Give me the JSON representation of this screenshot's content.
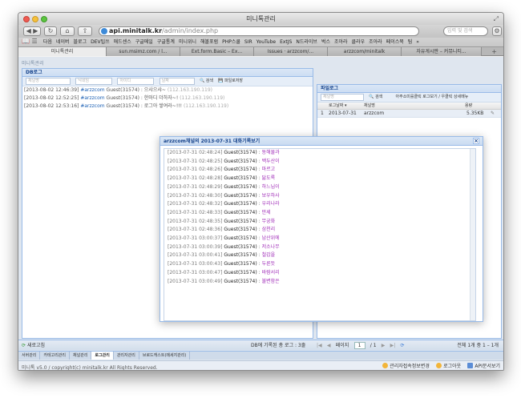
{
  "browser": {
    "window_title": "미니톡관리",
    "url_host": "api.minitalk.kr",
    "url_path": "/admin/index.php",
    "search_placeholder": "입력 및 검색",
    "bookmarks": [
      "다음",
      "네이버",
      "블로그",
      "DEV팁쓰",
      "애드센스",
      "구글메일",
      "구글통계",
      "미니위니",
      "해볼포럼",
      "PHP스쿨",
      "SIR",
      "YouTube",
      "ExtJS",
      "N드라이브",
      "벅스",
      "조아라",
      "클라우",
      "조아라",
      "페이스북",
      "팀",
      "»"
    ],
    "tabs": [
      "미니톡관리",
      "sun.msimz.com / l...",
      "Ext.form.Basic – Ex...",
      "Issues · arzzcom/...",
      "arzzcom/minitalk",
      "자유게시판 – 커뮤니티..."
    ]
  },
  "app": {
    "title": "미니톡관리",
    "log_panel": {
      "title": "DB로그",
      "fields": [
        "채널명",
        "닉네임",
        "아이디",
        "날짜"
      ],
      "search_label": "검색",
      "save_label": "파일로저장",
      "lines": [
        {
          "time": "[2013-08-02 12:46:39]",
          "channel": "#arzzcom",
          "user": "Guest(31574)",
          "text": " : 으샤으샤~",
          "ip": "(112.163.190.119)"
        },
        {
          "time": "[2013-08-02 12:52:25]",
          "channel": "#arzzcom",
          "user": "Guest(31574)",
          "text": " : 한마디 더하자~!",
          "ip": "(112.163.190.119)"
        },
        {
          "time": "[2013-08-02 12:53:16]",
          "channel": "#arzzcom",
          "user": "Guest(31574)",
          "text": " : 로그아 쌓여라~!!!",
          "ip": "(112.163.190.119)"
        }
      ]
    },
    "file_panel": {
      "title": "파일로그",
      "field_channel": "채널명",
      "search_label": "검색",
      "hint": "아주소미를클릭 로그보기 / 우클릭 상세메뉴",
      "col_date": "로그날짜 ▾",
      "col_channel": "채널명",
      "col_size": "용량",
      "rows": [
        {
          "num": "1",
          "date": "2013-07-31",
          "channel": "arzzcom",
          "size": "5.35KB"
        }
      ]
    },
    "dialog": {
      "title": "arzzcom채널의 2013-07-31 대화기록보기",
      "close": "×",
      "messages": [
        {
          "time": "[2013-07-31 02:48:24]",
          "user": "Guest(31574)",
          "text": "동해물과"
        },
        {
          "time": "[2013-07-31 02:48:25]",
          "user": "Guest(31574)",
          "text": "백두산이"
        },
        {
          "time": "[2013-07-31 02:48:26]",
          "user": "Guest(31574)",
          "text": "마르고"
        },
        {
          "time": "[2013-07-31 02:48:28]",
          "user": "Guest(31574)",
          "text": "닳도록"
        },
        {
          "time": "[2013-07-31 02:48:29]",
          "user": "Guest(31574)",
          "text": "하느님이"
        },
        {
          "time": "[2013-07-31 02:48:30]",
          "user": "Guest(31574)",
          "text": "보우하사"
        },
        {
          "time": "[2013-07-31 02:48:32]",
          "user": "Guest(31574)",
          "text": "우리나라"
        },
        {
          "time": "[2013-07-31 02:48:33]",
          "user": "Guest(31574)",
          "text": "만세"
        },
        {
          "time": "[2013-07-31 02:48:35]",
          "user": "Guest(31574)",
          "text": "무궁화"
        },
        {
          "time": "[2013-07-31 02:48:36]",
          "user": "Guest(31574)",
          "text": "삼천리"
        },
        {
          "time": "[2013-07-31 03:00:37]",
          "user": "Guest(31574)",
          "text": "남산위에"
        },
        {
          "time": "[2013-07-31 03:00:39]",
          "user": "Guest(31574)",
          "text": "저소나무"
        },
        {
          "time": "[2013-07-31 03:00:41]",
          "user": "Guest(31574)",
          "text": "철갑을"
        },
        {
          "time": "[2013-07-31 03:00:43]",
          "user": "Guest(31574)",
          "text": "두른듯"
        },
        {
          "time": "[2013-07-31 03:00:47]",
          "user": "Guest(31574)",
          "text": "바람서리"
        },
        {
          "time": "[2013-07-31 03:00:49]",
          "user": "Guest(31574)",
          "text": "불변함은"
        }
      ]
    },
    "bottom": {
      "reset": "새로고침",
      "log_count": "DB에 기록된 총 로그 : 3줄",
      "page_label": "페이지",
      "page_value": "1",
      "page_total": "/ 1",
      "file_count": "전체 1개 중 1 – 1개"
    },
    "bottom_tabs": [
      "서버관리",
      "카테고리관리",
      "채널관리",
      "로그관리",
      "관리자관리",
      "브로드캐스트(메세지관리)"
    ],
    "active_bottom_tab": "로그관리",
    "status": {
      "copyright": "미니톡 v5.0 / copyright(c) minitalk.kr All Rights Reserved.",
      "links": [
        "관리자접속정보변경",
        "로그아웃",
        "API문서보기"
      ]
    }
  },
  "colors": {
    "accent_blue": "#15428b",
    "user_link": "#1a5fb4",
    "message_purple": "#a02cb8"
  }
}
